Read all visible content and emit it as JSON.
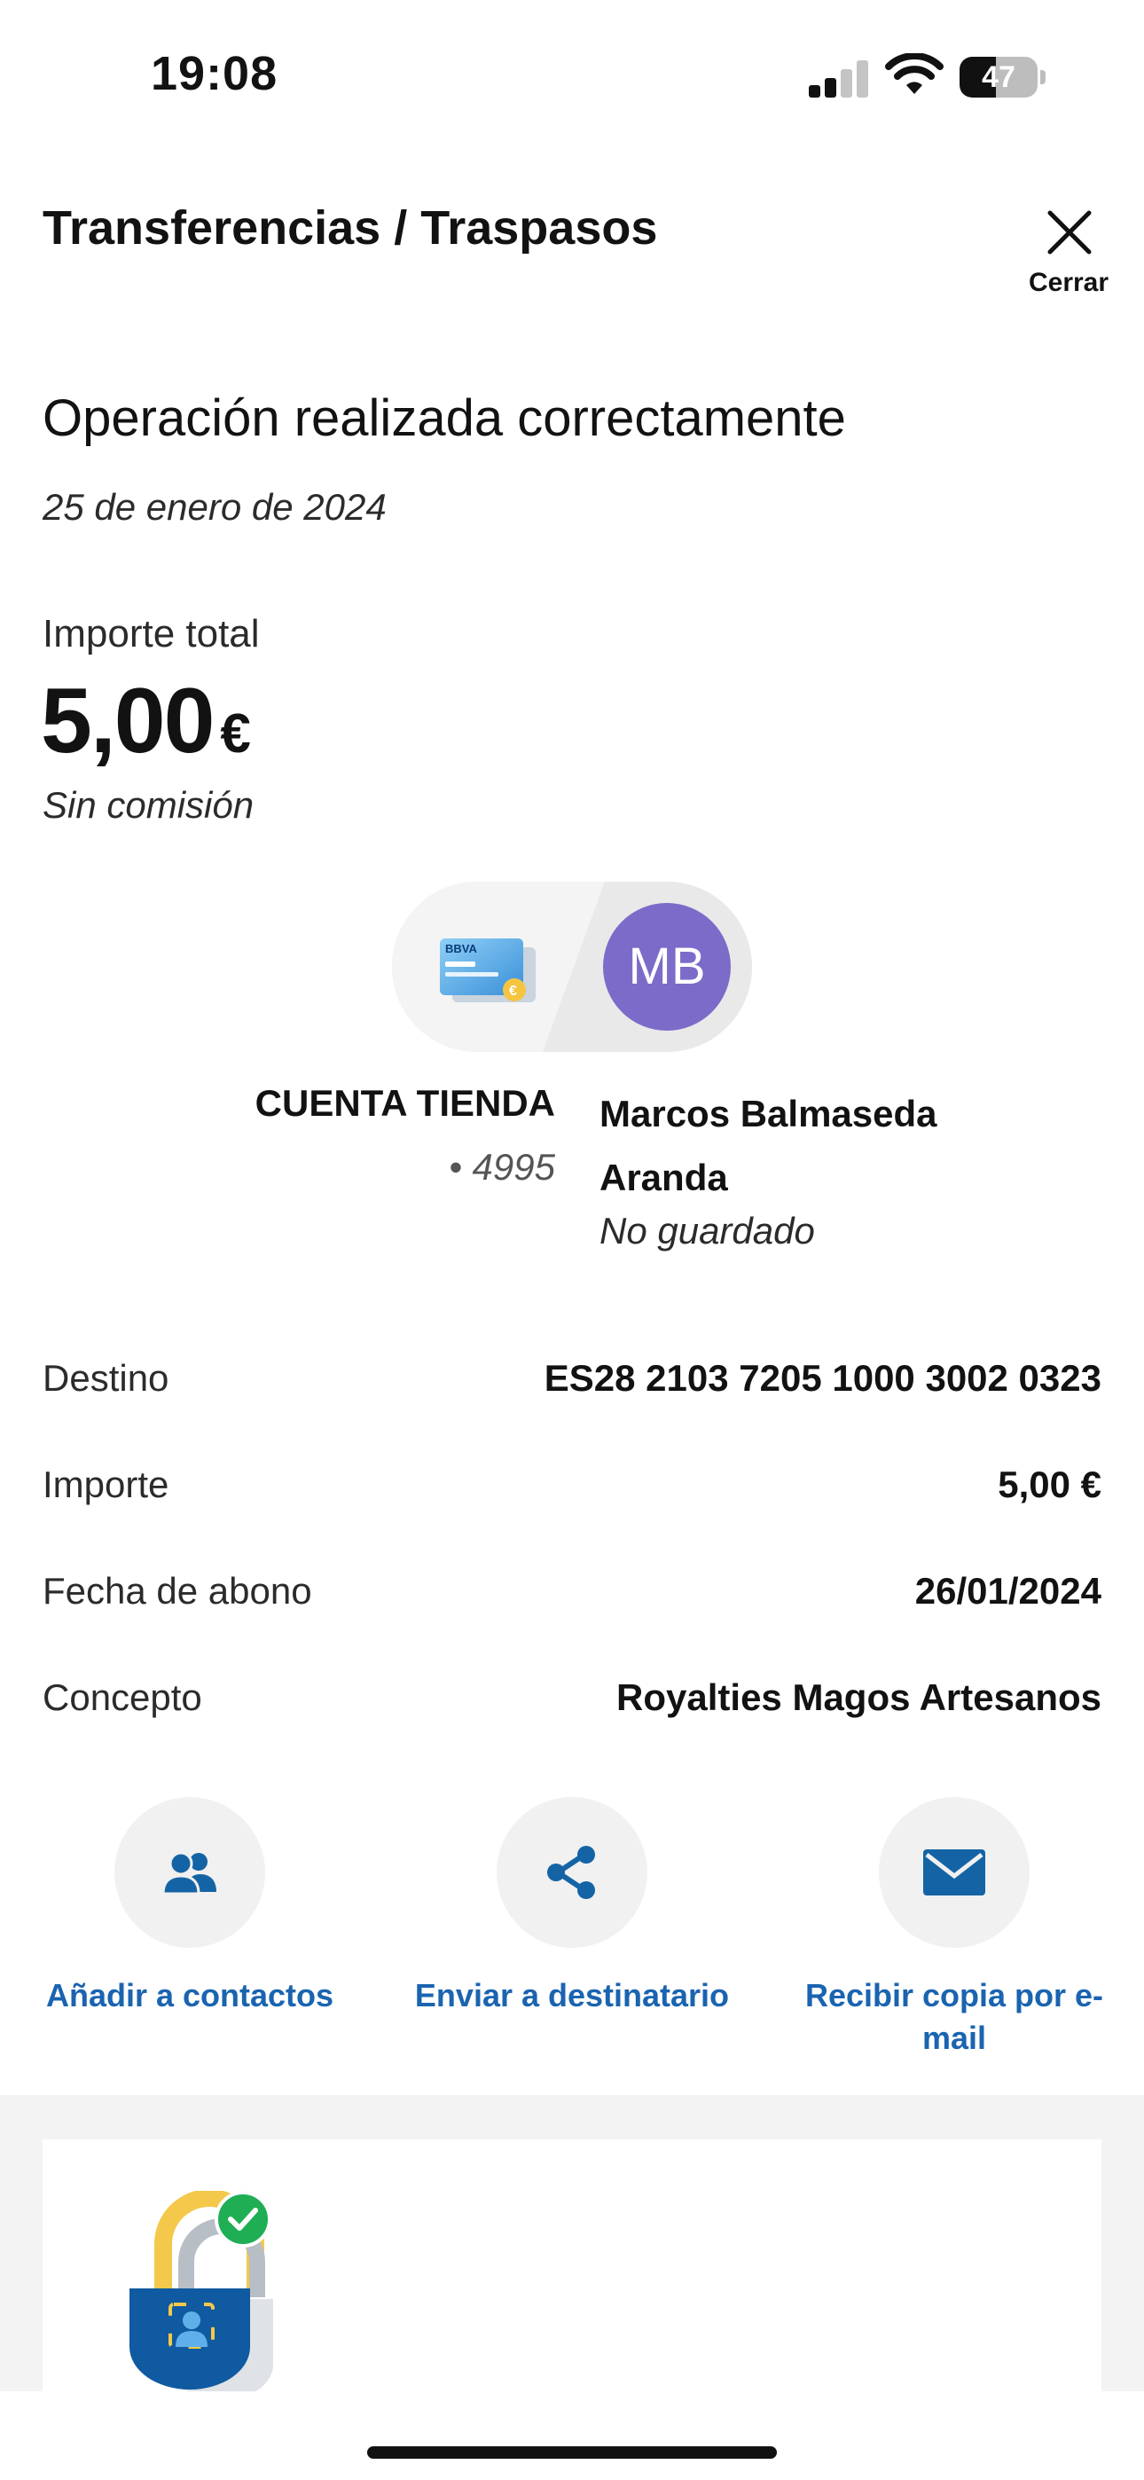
{
  "status_bar": {
    "time": "19:08",
    "battery": "47",
    "battery_level": 0.47
  },
  "header": {
    "title": "Transferencias / Traspasos",
    "close_label": "Cerrar"
  },
  "operation": {
    "title": "Operación realizada correctamente",
    "date": "25 de enero de 2024"
  },
  "amount": {
    "label": "Importe total",
    "value": "5,00",
    "currency": "€",
    "note": "Sin comisión"
  },
  "transfer": {
    "card_brand": "BBVA",
    "avatar_initials": "MB",
    "avatar_color": "#7c6bc9",
    "origin_name": "CUENTA TIENDA",
    "origin_account": "• 4995",
    "dest_name_line1": "Marcos Balmaseda",
    "dest_name_line2": "Aranda",
    "dest_status": "No guardado"
  },
  "details": [
    {
      "label": "Destino",
      "value": "ES28 2103 7205 1000 3002 0323"
    },
    {
      "label": "Importe",
      "value": "5,00 €"
    },
    {
      "label": "Fecha de abono",
      "value": "26/01/2024"
    },
    {
      "label": "Concepto",
      "value": "Royalties Magos Artesanos"
    }
  ],
  "actions": [
    {
      "label": "Añadir a contactos",
      "icon": "contacts-icon"
    },
    {
      "label": "Enviar a destinatario",
      "icon": "share-icon"
    },
    {
      "label": "Recibir copia por e-mail",
      "icon": "mail-icon"
    }
  ],
  "colors": {
    "accent": "#1a64b0",
    "icon_blue": "#1464a5",
    "success_green": "#1fae54"
  }
}
